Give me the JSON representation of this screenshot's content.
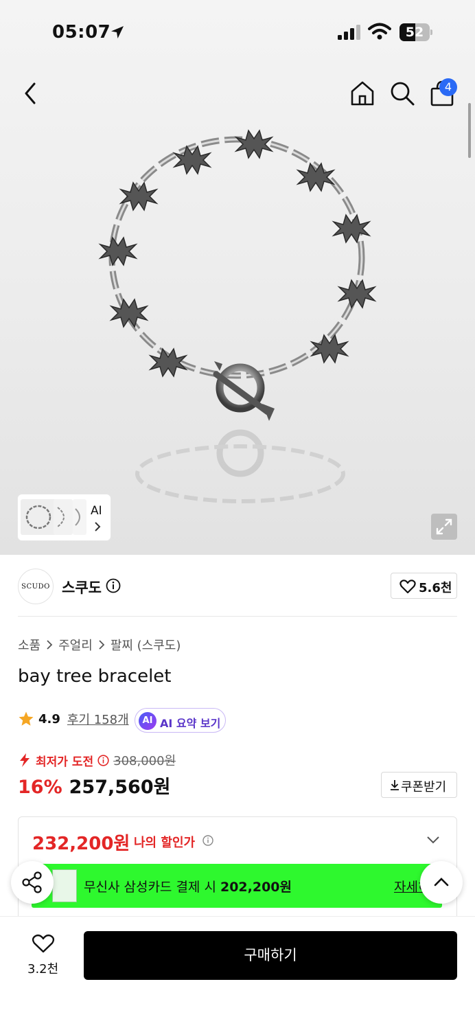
{
  "status_bar": {
    "time": "05:07",
    "battery": "52",
    "battery_level": 0.52
  },
  "header": {
    "cart_count": "4"
  },
  "gallery": {
    "thumbs_label": "AI"
  },
  "brand": {
    "logo_text": "SCUDO",
    "name": "스쿠도",
    "likes": "5.6천"
  },
  "breadcrumb": [
    "소품",
    "주얼리",
    "팔찌 (스쿠도)"
  ],
  "product": {
    "title": "bay tree bracelet",
    "rating": "4.9",
    "reviews": "후기 158개",
    "ai_summary": {
      "badge": "AI",
      "label": "AI 요약 보기"
    },
    "challenge_label": "최저가 도전",
    "original_price": "308,000원",
    "discount": "16%",
    "price": "257,560원",
    "coupon_label": "쿠폰받기"
  },
  "my_price": {
    "value": "232,200원",
    "label": "나의 할인가"
  },
  "card_promo": {
    "text": "무신사 삼성카드 결제 시 ",
    "amount": "202,200원",
    "more": "자세히"
  },
  "bottom_bar": {
    "wish_count": "3.2천",
    "buy_label": "구매하기"
  },
  "colors": {
    "sale_red": "#e32626",
    "promo_green": "#2ef82e",
    "badge_blue": "#2a6af5",
    "ai_purple": "#5a35c9"
  }
}
